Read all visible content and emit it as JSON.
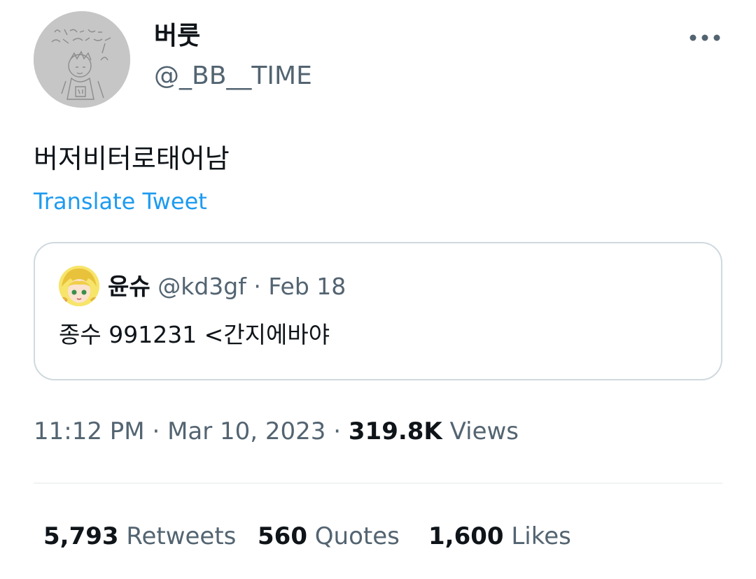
{
  "author": {
    "display_name": "버룻",
    "handle": "@_BB__TIME",
    "avatar_icon": "sketch-avatar"
  },
  "more_icon": "more-horizontal-icon",
  "tweet": {
    "text": "버저비터로태어남",
    "translate_label": "Translate Tweet"
  },
  "quoted": {
    "name": "윤슈",
    "handle": "@kd3gf",
    "separator": "·",
    "date": "Feb 18",
    "text": "종수 991231 <간지에바야",
    "avatar_icon": "anime-avatar"
  },
  "meta": {
    "time": "11:12 PM",
    "sep1": "·",
    "date": "Mar 10, 2023",
    "sep2": "·",
    "views_count": "319.8K",
    "views_label": "Views"
  },
  "stats": {
    "retweets_count": "5,793",
    "retweets_label": "Retweets",
    "quotes_count": "560",
    "quotes_label": "Quotes",
    "likes_count": "1,600",
    "likes_label": "Likes"
  },
  "colors": {
    "link": "#1d9bf0",
    "secondary_text": "#536471",
    "primary_text": "#0f1419",
    "border": "#cfd9de"
  }
}
